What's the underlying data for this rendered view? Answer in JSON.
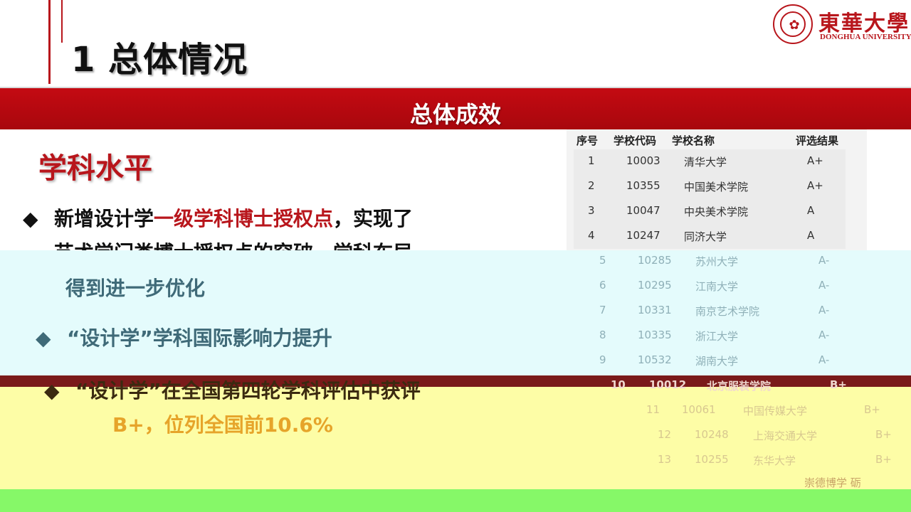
{
  "page_title": "1 总体情况",
  "logo": {
    "cn": "東華大學",
    "en": "DONGHUA UNIVERSITY"
  },
  "banner": "总体成效",
  "section_title": "学科水平",
  "bullets": {
    "b1_prefix": "新增设计学",
    "b1_highlight": "一级学科博士授权点",
    "b1_suffix": "，实现了",
    "b1_line2": "艺术学门类博士授权点的突破，学科布局",
    "b1_line3": "得到进一步优化",
    "b2": "“设计学”学科国际影响力提升",
    "b3": "“设计学”在全国第四轮学科评估中获评",
    "b3_line2": "B+，位列全国前10.6%"
  },
  "table": {
    "headers": [
      "序号",
      "学校代码",
      "学校名称",
      "评选结果"
    ],
    "rows": [
      [
        "1",
        "10003",
        "清华大学",
        "A+"
      ],
      [
        "2",
        "10355",
        "中国美术学院",
        "A+"
      ],
      [
        "3",
        "10047",
        "中央美术学院",
        "A"
      ],
      [
        "4",
        "10247",
        "同济大学",
        "A"
      ],
      [
        "5",
        "10285",
        "苏州大学",
        "A-"
      ],
      [
        "6",
        "10295",
        "江南大学",
        "A-"
      ],
      [
        "7",
        "10331",
        "南京艺术学院",
        "A-"
      ],
      [
        "8",
        "10335",
        "浙江大学",
        "A-"
      ],
      [
        "9",
        "10532",
        "湖南大学",
        "A-"
      ],
      [
        "10",
        "10012",
        "北京服装学院",
        "B+"
      ],
      [
        "11",
        "10061",
        "中国传媒大学",
        "B+"
      ],
      [
        "12",
        "10248",
        "上海交通大学",
        "B+"
      ],
      [
        "13",
        "10255",
        "东华大学",
        "B+"
      ]
    ]
  },
  "footer_motto": "崇德博学  砺"
}
